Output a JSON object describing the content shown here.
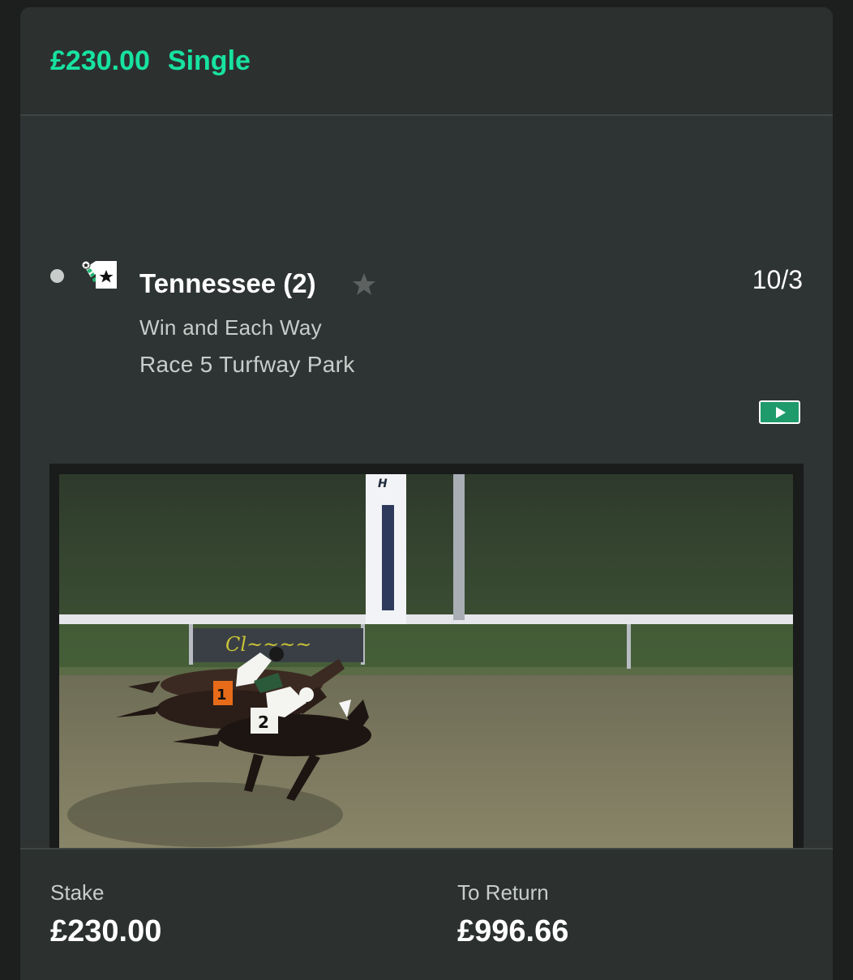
{
  "bet": {
    "amount": "£230.00",
    "type": "Single"
  },
  "selection": {
    "runner_name": "Tennessee (2)",
    "odds": "10/3",
    "market": "Win and Each Way",
    "event": "Race 5 Turfway Park",
    "status_icon": "dot-icon",
    "favourite_icon": "star-icon",
    "silk_icon": "jockey-silk-icon"
  },
  "video": {
    "play_icon": "play-icon",
    "tower_letter": "H",
    "saddle_cloth_numbers": [
      "1",
      "2"
    ]
  },
  "footer": {
    "stake_label": "Stake",
    "stake_value": "£230.00",
    "return_label": "To Return",
    "return_value": "£996.66"
  },
  "colors": {
    "accent": "#17e3a0",
    "card_bg": "#2f3433",
    "play_button": "#1f9a6b"
  }
}
